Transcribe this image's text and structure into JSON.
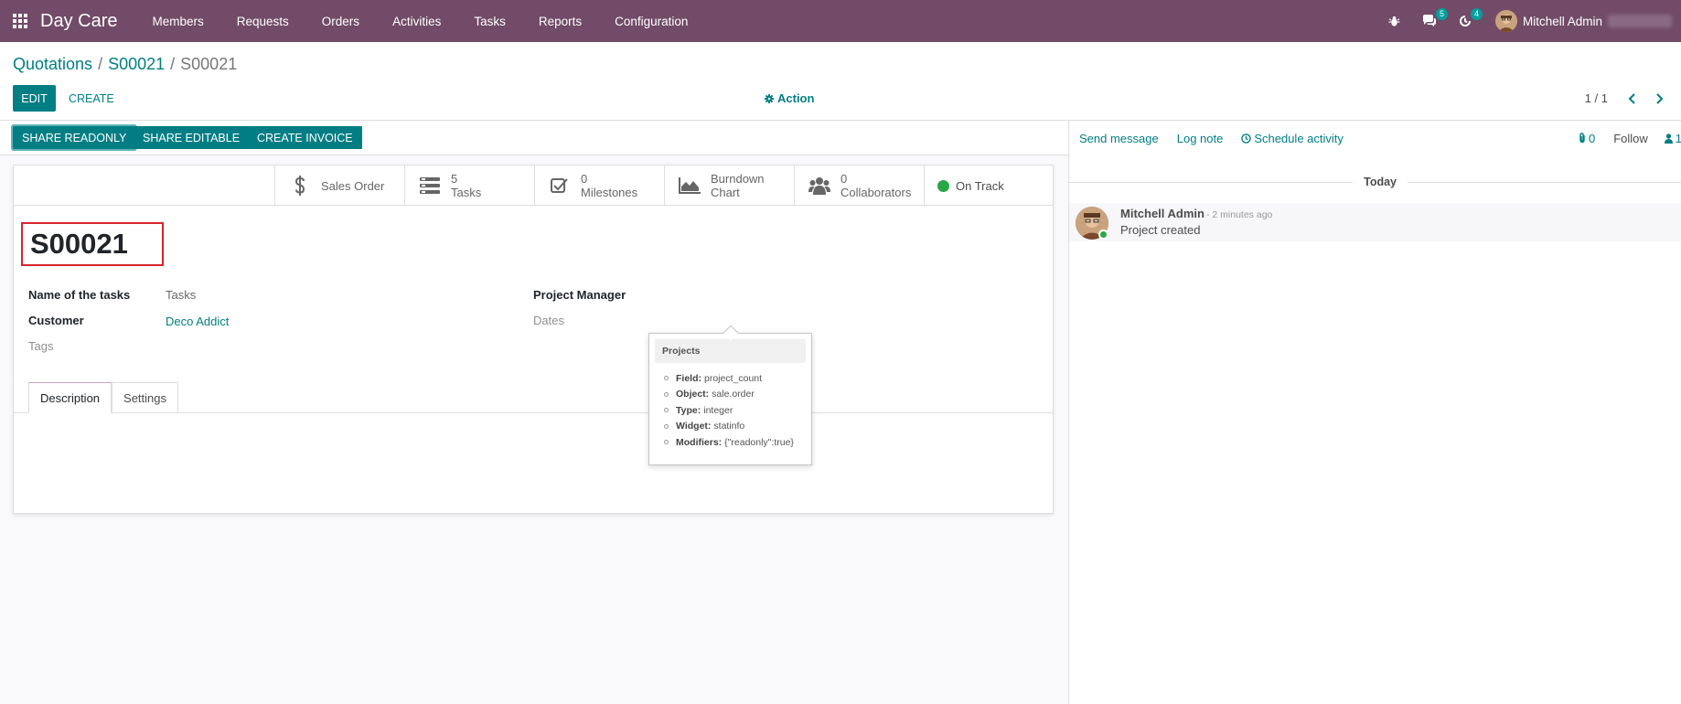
{
  "navbar": {
    "brand": "Day Care",
    "menu": [
      "Members",
      "Requests",
      "Orders",
      "Activities",
      "Tasks",
      "Reports",
      "Configuration"
    ],
    "messages_badge": "5",
    "activities_badge": "4",
    "user_name": "Mitchell Admin"
  },
  "breadcrumb": {
    "items": [
      "Quotations",
      "S00021"
    ],
    "separator": "/",
    "current": "S00021"
  },
  "control": {
    "edit_label": "EDIT",
    "create_label": "CREATE",
    "action_label": "Action",
    "pager": "1 / 1"
  },
  "statusbar": {
    "buttons": [
      "SHARE READONLY",
      "SHARE EDITABLE",
      "CREATE INVOICE"
    ]
  },
  "stat_buttons": {
    "sales_order": "Sales Order",
    "tasks_value": "5",
    "tasks_label": "Tasks",
    "milestones_value": "0",
    "milestones_label": "Milestones",
    "burndown_line1": "Burndown",
    "burndown_line2": "Chart",
    "collaborators_value": "0",
    "collaborators_label": "Collaborators",
    "status": "On Track"
  },
  "form": {
    "title": "S00021",
    "name_of_tasks_label": "Name of the tasks",
    "name_of_tasks_value": "Tasks",
    "customer_label": "Customer",
    "customer_value": "Deco Addict",
    "tags_label": "Tags",
    "project_manager_label": "Project Manager",
    "dates_label": "Dates",
    "tabs": [
      "Description",
      "Settings"
    ]
  },
  "tooltip": {
    "header": "Projects",
    "rows": [
      {
        "key": "Field:",
        "value": "project_count"
      },
      {
        "key": "Object:",
        "value": "sale.order"
      },
      {
        "key": "Type:",
        "value": "integer"
      },
      {
        "key": "Widget:",
        "value": "statinfo"
      },
      {
        "key": "Modifiers:",
        "value": "{\"readonly\":true}"
      }
    ]
  },
  "chatter": {
    "send_message": "Send message",
    "log_note": "Log note",
    "schedule_activity": "Schedule activity",
    "attachments": "0",
    "follow": "Follow",
    "followers": "1",
    "today": "Today",
    "message": {
      "author": "Mitchell Admin",
      "date": "- 2 minutes ago",
      "body": "Project created"
    }
  },
  "colors": {
    "navbar": "#714b67",
    "primary": "#017e84",
    "status_on_track": "#28a745",
    "highlight_border": "#d9232d"
  }
}
